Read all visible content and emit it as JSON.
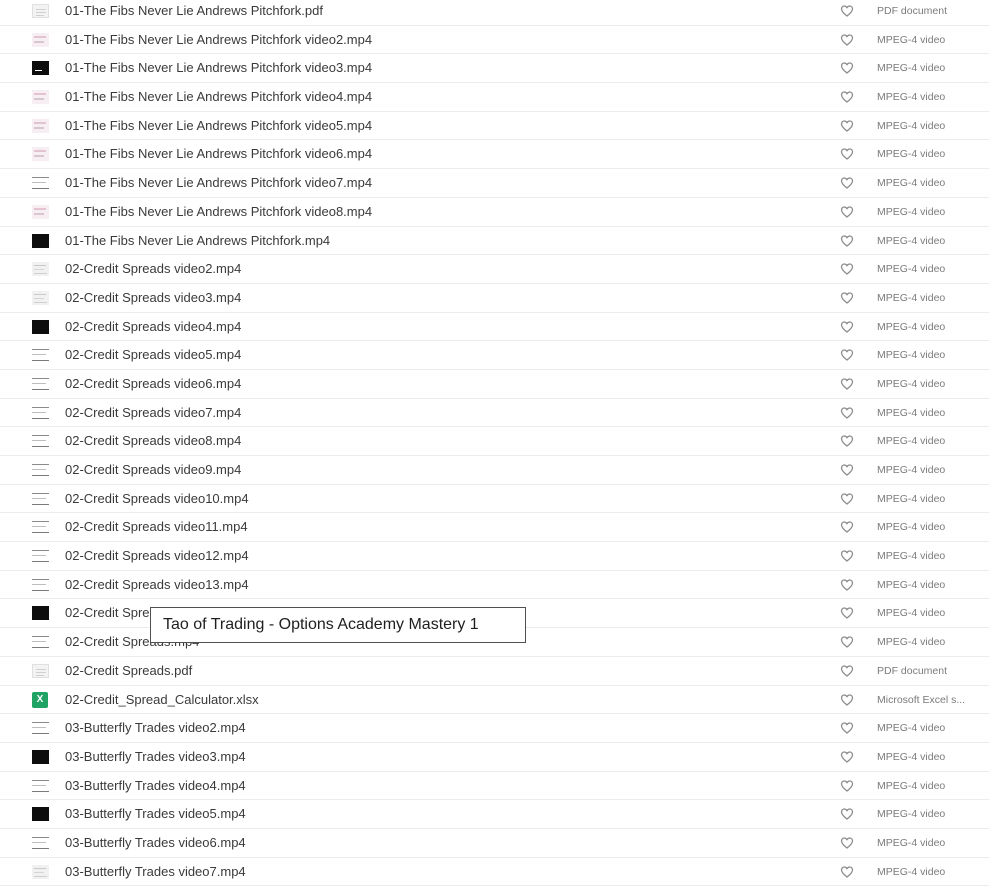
{
  "tooltip": "Tao of Trading - Options Academy Mastery 1",
  "files": [
    {
      "name": "01-The Fibs Never Lie Andrews Pitchfork.pdf",
      "type": "PDF document",
      "thumb": "doc"
    },
    {
      "name": "01-The Fibs Never Lie Andrews Pitchfork video2.mp4",
      "type": "MPEG-4 video",
      "thumb": "pink"
    },
    {
      "name": "01-The Fibs Never Lie Andrews Pitchfork video3.mp4",
      "type": "MPEG-4 video",
      "thumb": "darkline"
    },
    {
      "name": "01-The Fibs Never Lie Andrews Pitchfork video4.mp4",
      "type": "MPEG-4 video",
      "thumb": "pink"
    },
    {
      "name": "01-The Fibs Never Lie Andrews Pitchfork video5.mp4",
      "type": "MPEG-4 video",
      "thumb": "pink"
    },
    {
      "name": "01-The Fibs Never Lie Andrews Pitchfork video6.mp4",
      "type": "MPEG-4 video",
      "thumb": "pink"
    },
    {
      "name": "01-The Fibs Never Lie Andrews Pitchfork video7.mp4",
      "type": "MPEG-4 video",
      "thumb": "lines"
    },
    {
      "name": "01-The Fibs Never Lie Andrews Pitchfork video8.mp4",
      "type": "MPEG-4 video",
      "thumb": "pink"
    },
    {
      "name": "01-The Fibs Never Lie Andrews Pitchfork.mp4",
      "type": "MPEG-4 video",
      "thumb": "dark"
    },
    {
      "name": "02-Credit Spreads video2.mp4",
      "type": "MPEG-4 video",
      "thumb": "light"
    },
    {
      "name": "02-Credit Spreads video3.mp4",
      "type": "MPEG-4 video",
      "thumb": "light"
    },
    {
      "name": "02-Credit Spreads video4.mp4",
      "type": "MPEG-4 video",
      "thumb": "dark"
    },
    {
      "name": "02-Credit Spreads video5.mp4",
      "type": "MPEG-4 video",
      "thumb": "lines"
    },
    {
      "name": "02-Credit Spreads video6.mp4",
      "type": "MPEG-4 video",
      "thumb": "lines"
    },
    {
      "name": "02-Credit Spreads video7.mp4",
      "type": "MPEG-4 video",
      "thumb": "lines"
    },
    {
      "name": "02-Credit Spreads video8.mp4",
      "type": "MPEG-4 video",
      "thumb": "lines"
    },
    {
      "name": "02-Credit Spreads video9.mp4",
      "type": "MPEG-4 video",
      "thumb": "lines"
    },
    {
      "name": "02-Credit Spreads video10.mp4",
      "type": "MPEG-4 video",
      "thumb": "lines"
    },
    {
      "name": "02-Credit Spreads video11.mp4",
      "type": "MPEG-4 video",
      "thumb": "lines"
    },
    {
      "name": "02-Credit Spreads video12.mp4",
      "type": "MPEG-4 video",
      "thumb": "lines"
    },
    {
      "name": "02-Credit Spreads video13.mp4",
      "type": "MPEG-4 video",
      "thumb": "lines"
    },
    {
      "name": "02-Credit Spre",
      "type": "MPEG-4 video",
      "thumb": "dark"
    },
    {
      "name": "02-Credit Spreads.mp4",
      "type": "MPEG-4 video",
      "thumb": "lines"
    },
    {
      "name": "02-Credit Spreads.pdf",
      "type": "PDF document",
      "thumb": "doc"
    },
    {
      "name": "02-Credit_Spread_Calculator.xlsx",
      "type": "Microsoft Excel s...",
      "thumb": "excel",
      "thumb_label": "X"
    },
    {
      "name": "03-Butterfly Trades video2.mp4",
      "type": "MPEG-4 video",
      "thumb": "lines"
    },
    {
      "name": "03-Butterfly Trades video3.mp4",
      "type": "MPEG-4 video",
      "thumb": "dark"
    },
    {
      "name": "03-Butterfly Trades video4.mp4",
      "type": "MPEG-4 video",
      "thumb": "lines"
    },
    {
      "name": "03-Butterfly Trades video5.mp4",
      "type": "MPEG-4 video",
      "thumb": "dark"
    },
    {
      "name": "03-Butterfly Trades video6.mp4",
      "type": "MPEG-4 video",
      "thumb": "lines"
    },
    {
      "name": "03-Butterfly Trades video7.mp4",
      "type": "MPEG-4 video",
      "thumb": "light"
    }
  ]
}
